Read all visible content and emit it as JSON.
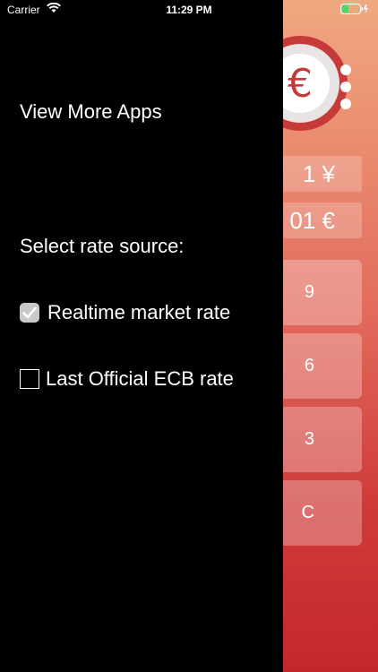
{
  "status": {
    "carrier": "Carrier",
    "time": "11:29 PM"
  },
  "drawer": {
    "view_more": "View More Apps",
    "select_label": "Select rate source:",
    "options": [
      {
        "label": "Realtime market rate",
        "checked": true
      },
      {
        "label": "Last Official ECB rate",
        "checked": false
      }
    ]
  },
  "app": {
    "display_top": "1 ¥",
    "display_bottom": "01 €",
    "keys": [
      "9",
      "6",
      "3",
      "C"
    ],
    "colors": {
      "gradient_top": "#f0a880",
      "gradient_bottom": "#c5262d"
    }
  }
}
